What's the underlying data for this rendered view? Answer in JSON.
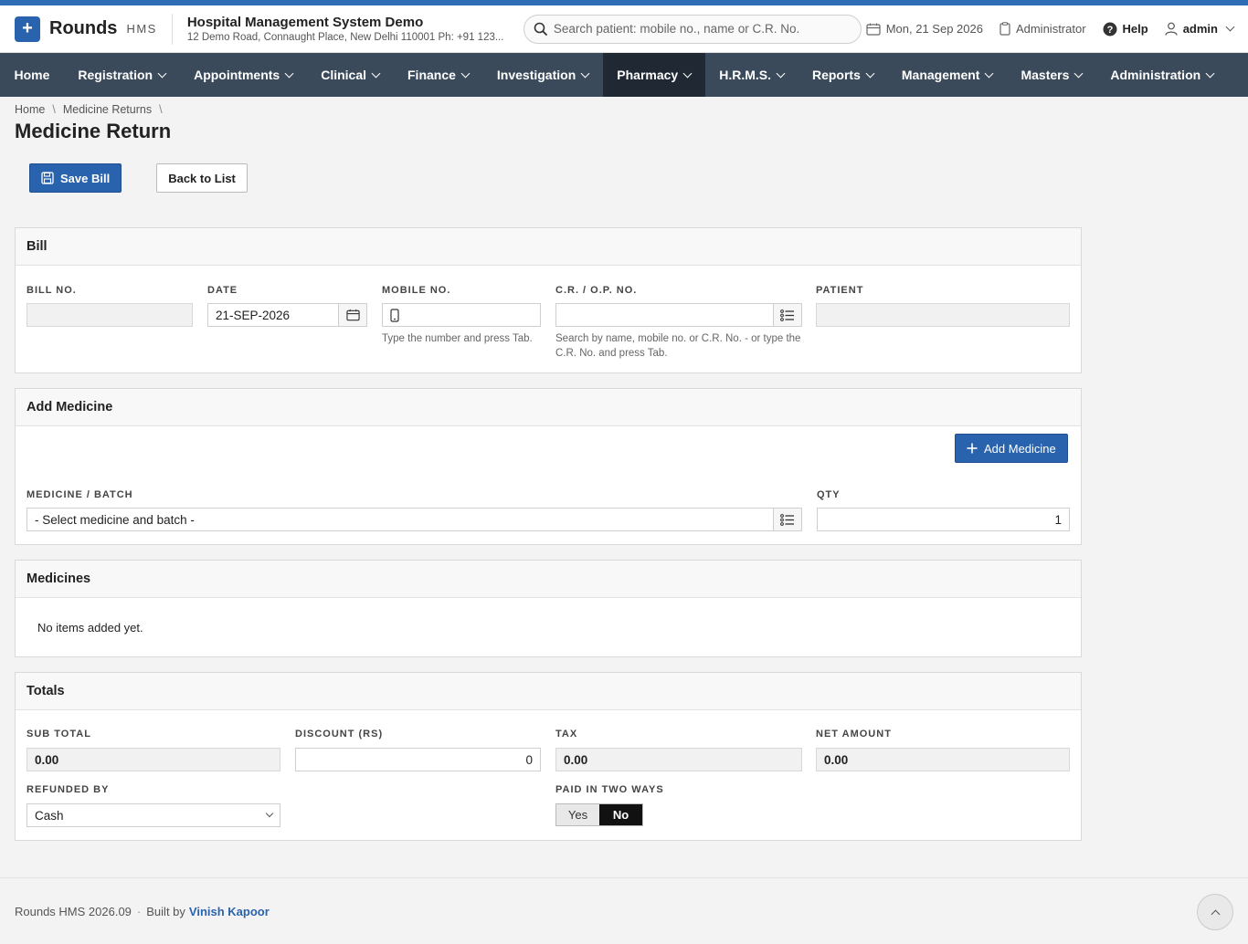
{
  "header": {
    "brand": "Rounds",
    "brand_sub": "HMS",
    "hospital_name": "Hospital Management System Demo",
    "hospital_address": "12 Demo Road, Connaught Place, New Delhi 110001 Ph: +91 123...",
    "search_placeholder": "Search patient: mobile no., name or C.R. No.",
    "date": "Mon, 21 Sep 2026",
    "role": "Administrator",
    "help": "Help",
    "user": "admin"
  },
  "nav": {
    "items": [
      "Home",
      "Registration",
      "Appointments",
      "Clinical",
      "Finance",
      "Investigation",
      "Pharmacy",
      "H.R.M.S.",
      "Reports",
      "Management",
      "Masters",
      "Administration"
    ]
  },
  "breadcrumb": {
    "home": "Home",
    "section": "Medicine Returns"
  },
  "page_title": "Medicine Return",
  "toolbar": {
    "save": "Save Bill",
    "back": "Back to List"
  },
  "bill": {
    "heading": "Bill",
    "bill_no_label": "BILL NO.",
    "bill_no_value": "",
    "date_label": "DATE",
    "date_value": "21-SEP-2026",
    "mobile_label": "MOBILE NO.",
    "mobile_value": "",
    "mobile_help": "Type the number and press Tab.",
    "cr_label": "C.R. / O.P. NO.",
    "cr_value": "",
    "cr_help": "Search by name, mobile no. or C.R. No. - or type the C.R. No. and press Tab.",
    "patient_label": "PATIENT",
    "patient_value": ""
  },
  "add_medicine": {
    "heading": "Add Medicine",
    "button": "Add Medicine",
    "medicine_label": "MEDICINE / BATCH",
    "medicine_value": "- Select medicine and batch -",
    "qty_label": "QTY",
    "qty_value": "1"
  },
  "medicines": {
    "heading": "Medicines",
    "empty": "No items added yet."
  },
  "totals": {
    "heading": "Totals",
    "subtotal_label": "SUB TOTAL",
    "subtotal_value": "0.00",
    "discount_label": "DISCOUNT (RS)",
    "discount_value": "0",
    "tax_label": "TAX",
    "tax_value": "0.00",
    "net_label": "NET AMOUNT",
    "net_value": "0.00",
    "refunded_label": "REFUNDED BY",
    "refunded_value": "Cash",
    "paid_two_label": "PAID IN TWO WAYS",
    "paid_two_yes": "Yes",
    "paid_two_no": "No",
    "paid_two_selected": "No"
  },
  "footer": {
    "version": "Rounds HMS 2026.09",
    "built_by": "Built by",
    "author": "Vinish Kapoor"
  },
  "colors": {
    "accent": "#2a63ad",
    "nav_bg": "#3b4a5a",
    "nav_active": "#1f2833"
  }
}
